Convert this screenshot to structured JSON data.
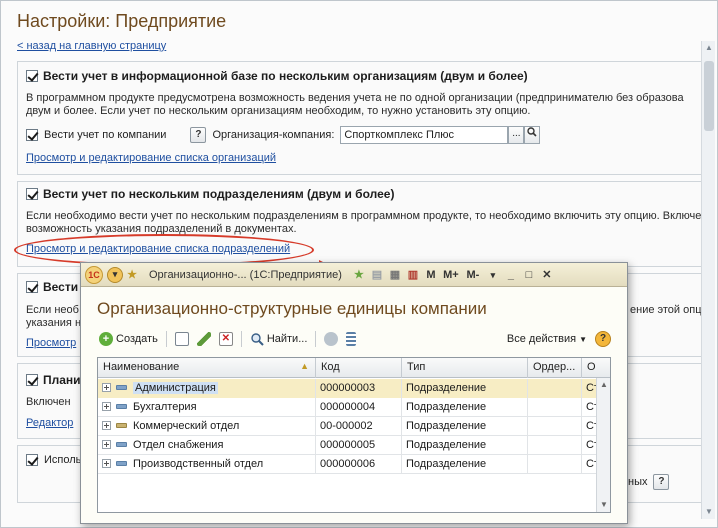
{
  "page": {
    "title": "Настройки: Предприятие",
    "back_link": "< назад на главную страницу"
  },
  "sections": {
    "orgs": {
      "header": "Вести учет в информационной базе по нескольким организациям (двум и более)",
      "desc_line1": "В программном продукте предусмотрена возможность ведения учета не по одной организации (предпринимателю без образова",
      "desc_line2": "двум и более. Если учет по нескольким организациям необходим, то нужно установить эту опцию.",
      "by_company_label": "Вести учет по компании",
      "help": "?",
      "org_company_label": "Организация-компания:",
      "org_company_value": "Спорткомплекс Плюс",
      "dots": "...",
      "link": "Просмотр и редактирование списка организаций"
    },
    "subdivs": {
      "header": "Вести учет по нескольким подразделениям (двум и более)",
      "desc_line1": "Если необходимо вести учет по нескольким подразделениям в программном продукте, то необходимо включить эту опцию. Включе",
      "desc_line2": "возможность указания подразделений в документах.",
      "link": "Просмотр и редактирование списка подразделений"
    },
    "third": {
      "header_partial": "Вести",
      "desc_partial1": "Если необ",
      "desc_partial2": "указания н",
      "desc_right": "ение этой опци",
      "link_partial": "Просмотр"
    },
    "fourth": {
      "header_partial": "Плани",
      "desc_partial": "Включен",
      "link_partial": "Редактор"
    },
    "fifth": {
      "label_partial": "Исполь",
      "right_text": "ных",
      "help": "?"
    }
  },
  "modal": {
    "title": "Организационно-... (1С:Предприятие)",
    "heading": "Организационно-структурные единицы компании",
    "titlebar_buttons": [
      "M",
      "M+",
      "M-"
    ],
    "toolbar": {
      "create": "Создать",
      "find": "Найти...",
      "all_actions": "Все действия",
      "help": "?"
    },
    "columns": [
      "Наименование",
      "Код",
      "Тип",
      "Ордер...",
      "О"
    ],
    "rows": [
      {
        "name": "Администрация",
        "code": "000000003",
        "type": "Подразделение",
        "order": "",
        "o": "Ст"
      },
      {
        "name": "Бухгалтерия",
        "code": "000000004",
        "type": "Подразделение",
        "order": "",
        "o": "Ст"
      },
      {
        "name": "Коммерческий отдел",
        "code": "00-000002",
        "type": "Подразделение",
        "order": "",
        "o": "Ст"
      },
      {
        "name": "Отдел снабжения",
        "code": "000000005",
        "type": "Подразделение",
        "order": "",
        "o": "Ст"
      },
      {
        "name": "Производственный отдел",
        "code": "000000006",
        "type": "Подразделение",
        "order": "",
        "o": "Ст"
      }
    ]
  },
  "colors": {
    "title": "#6f4a1f",
    "link": "#1f4fa0",
    "highlight_oval": "#d63b2a",
    "selection": "#f7edc4"
  }
}
